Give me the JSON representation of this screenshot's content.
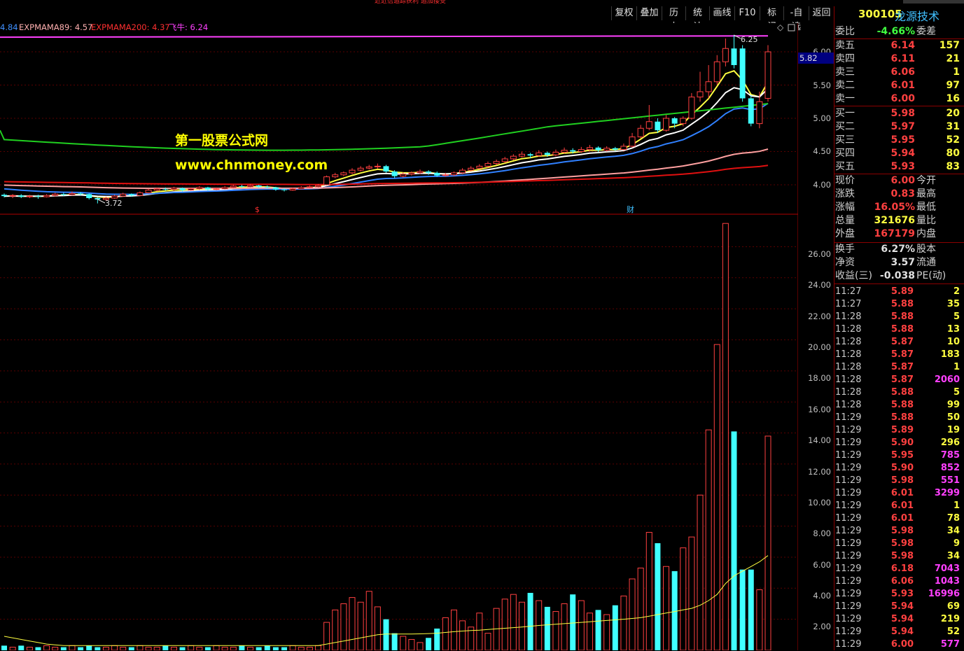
{
  "toolbar": {
    "buttons": [
      "复权",
      "叠加",
      "历史",
      "统计",
      "画线",
      "F10",
      "标记",
      "-自选",
      "返回"
    ],
    "stock_code": "300105",
    "stock_name": "龙源技术",
    "top_strip_text": "近近信追踪获利 追加接受"
  },
  "indicator_legend": [
    {
      "text": "4.84",
      "color": "#4090ff"
    },
    {
      "text": "EXPMAMA89: 4.57",
      "color": "#ffb0b0"
    },
    {
      "text": "EXPMAMA200: 4.37",
      "color": "#ff3030"
    },
    {
      "text": "飞牛: 6.24",
      "color": "#ff40ff"
    }
  ],
  "watermark": {
    "line1": "第一股票公式网",
    "line2": "www.chnmoney.com"
  },
  "price_axis": {
    "ticks": [
      "6.00",
      "5.50",
      "5.00",
      "4.50",
      "4.00"
    ],
    "current_marker": "5.82",
    "high_label": "6.25",
    "low_label": "3.72",
    "event_markers": [
      "$",
      "财"
    ]
  },
  "volume_axis": {
    "ticks": [
      "26.00",
      "24.00",
      "22.00",
      "20.00",
      "18.00",
      "16.00",
      "14.00",
      "12.00",
      "10.00",
      "8.00",
      "6.00",
      "4.00",
      "2.00"
    ]
  },
  "chart_data": {
    "type": "candlestick",
    "price_range": [
      3.55,
      6.35
    ],
    "volume_range": [
      0,
      27.5
    ],
    "candles": [
      [
        3.85,
        3.83,
        3.87,
        3.81
      ],
      [
        3.83,
        3.84,
        3.86,
        3.8
      ],
      [
        3.84,
        3.82,
        3.86,
        3.8
      ],
      [
        3.82,
        3.83,
        3.85,
        3.8
      ],
      [
        3.83,
        3.82,
        3.85,
        3.79
      ],
      [
        3.82,
        3.84,
        3.86,
        3.81
      ],
      [
        3.84,
        3.86,
        3.88,
        3.82
      ],
      [
        3.86,
        3.85,
        3.88,
        3.83
      ],
      [
        3.85,
        3.87,
        3.9,
        3.84
      ],
      [
        3.87,
        3.86,
        3.89,
        3.84
      ],
      [
        3.86,
        3.8,
        3.87,
        3.78
      ],
      [
        3.8,
        3.78,
        3.81,
        3.72
      ],
      [
        3.78,
        3.8,
        3.82,
        3.76
      ],
      [
        3.8,
        3.83,
        3.85,
        3.79
      ],
      [
        3.83,
        3.86,
        3.88,
        3.82
      ],
      [
        3.86,
        3.84,
        3.87,
        3.82
      ],
      [
        3.84,
        3.88,
        3.9,
        3.83
      ],
      [
        3.88,
        3.92,
        3.94,
        3.87
      ],
      [
        3.92,
        3.94,
        3.96,
        3.9
      ],
      [
        3.94,
        3.93,
        3.96,
        3.91
      ],
      [
        3.93,
        3.95,
        3.97,
        3.91
      ],
      [
        3.95,
        3.92,
        3.96,
        3.9
      ],
      [
        3.92,
        3.94,
        3.96,
        3.91
      ],
      [
        3.94,
        3.96,
        3.98,
        3.92
      ],
      [
        3.96,
        3.93,
        3.97,
        3.91
      ],
      [
        3.93,
        3.94,
        3.96,
        3.92
      ],
      [
        3.94,
        3.96,
        3.98,
        3.93
      ],
      [
        3.96,
        3.98,
        4.0,
        3.95
      ],
      [
        3.98,
        3.97,
        4.0,
        3.95
      ],
      [
        3.97,
        3.99,
        4.01,
        3.96
      ],
      [
        3.99,
        3.97,
        4.0,
        3.95
      ],
      [
        3.97,
        3.96,
        3.99,
        3.94
      ],
      [
        3.96,
        3.93,
        3.97,
        3.91
      ],
      [
        3.93,
        3.92,
        3.95,
        3.9
      ],
      [
        3.92,
        3.94,
        3.96,
        3.91
      ],
      [
        3.94,
        3.96,
        3.98,
        3.93
      ],
      [
        3.96,
        3.97,
        3.99,
        3.95
      ],
      [
        3.97,
        3.99,
        4.01,
        3.96
      ],
      [
        4.0,
        4.12,
        4.14,
        3.99
      ],
      [
        4.12,
        4.15,
        4.18,
        4.1
      ],
      [
        4.15,
        4.18,
        4.2,
        4.13
      ],
      [
        4.18,
        4.22,
        4.25,
        4.16
      ],
      [
        4.22,
        4.25,
        4.28,
        4.2
      ],
      [
        4.25,
        4.27,
        4.3,
        4.23
      ],
      [
        4.27,
        4.28,
        4.32,
        4.24
      ],
      [
        4.28,
        4.2,
        4.3,
        4.18
      ],
      [
        4.2,
        4.13,
        4.22,
        4.1
      ],
      [
        4.13,
        4.16,
        4.19,
        4.11
      ],
      [
        4.16,
        4.18,
        4.2,
        4.14
      ],
      [
        4.18,
        4.2,
        4.23,
        4.16
      ],
      [
        4.2,
        4.18,
        4.22,
        4.15
      ],
      [
        4.18,
        4.14,
        4.2,
        4.12
      ],
      [
        4.14,
        4.15,
        4.18,
        4.12
      ],
      [
        4.15,
        4.18,
        4.2,
        4.13
      ],
      [
        4.18,
        4.22,
        4.25,
        4.16
      ],
      [
        4.22,
        4.25,
        4.28,
        4.2
      ],
      [
        4.25,
        4.28,
        4.31,
        4.23
      ],
      [
        4.28,
        4.32,
        4.35,
        4.26
      ],
      [
        4.32,
        4.35,
        4.38,
        4.3
      ],
      [
        4.35,
        4.39,
        4.42,
        4.33
      ],
      [
        4.39,
        4.43,
        4.46,
        4.37
      ],
      [
        4.43,
        4.46,
        4.5,
        4.41
      ],
      [
        4.46,
        4.44,
        4.48,
        4.4
      ],
      [
        4.44,
        4.48,
        4.52,
        4.42
      ],
      [
        4.48,
        4.45,
        4.5,
        4.42
      ],
      [
        4.45,
        4.49,
        4.53,
        4.43
      ],
      [
        4.49,
        4.52,
        4.56,
        4.47
      ],
      [
        4.52,
        4.5,
        4.55,
        4.47
      ],
      [
        4.5,
        4.53,
        4.57,
        4.48
      ],
      [
        4.53,
        4.56,
        4.6,
        4.5
      ],
      [
        4.56,
        4.52,
        4.58,
        4.49
      ],
      [
        4.52,
        4.55,
        4.58,
        4.5
      ],
      [
        4.55,
        4.53,
        4.57,
        4.51
      ],
      [
        4.53,
        4.58,
        4.62,
        4.52
      ],
      [
        4.58,
        4.72,
        4.78,
        4.56
      ],
      [
        4.72,
        4.85,
        4.9,
        4.7
      ],
      [
        4.85,
        4.95,
        5.2,
        4.82
      ],
      [
        4.95,
        4.82,
        5.0,
        4.78
      ],
      [
        4.82,
        5.0,
        5.05,
        4.8
      ],
      [
        5.0,
        4.92,
        5.02,
        4.85
      ],
      [
        4.92,
        5.0,
        5.03,
        4.88
      ],
      [
        5.0,
        5.32,
        5.38,
        4.98
      ],
      [
        5.32,
        5.4,
        5.7,
        5.25
      ],
      [
        5.4,
        5.55,
        5.8,
        5.3
      ],
      [
        5.55,
        5.85,
        5.95,
        5.5
      ],
      [
        5.85,
        6.05,
        6.2,
        5.78
      ],
      [
        6.05,
        5.8,
        6.25,
        5.75
      ],
      [
        6.05,
        5.3,
        6.1,
        5.25
      ],
      [
        5.3,
        4.92,
        5.35,
        4.88
      ],
      [
        4.92,
        5.25,
        5.4,
        4.85
      ],
      [
        5.3,
        6.0,
        6.1,
        5.25
      ]
    ],
    "volumes": [
      0.3,
      0.2,
      0.3,
      0.2,
      0.2,
      0.3,
      0.2,
      0.2,
      0.3,
      0.2,
      0.3,
      0.2,
      0.2,
      0.3,
      0.2,
      0.2,
      0.3,
      0.2,
      0.2,
      0.3,
      0.2,
      0.2,
      0.3,
      0.2,
      0.2,
      0.3,
      0.2,
      0.2,
      0.3,
      0.2,
      0.2,
      0.3,
      0.2,
      0.2,
      0.3,
      0.2,
      0.2,
      0.3,
      1.8,
      2.6,
      3.0,
      3.4,
      3.1,
      3.8,
      2.8,
      2.0,
      1.1,
      0.9,
      0.7,
      0.5,
      0.8,
      1.4,
      2.1,
      2.6,
      1.9,
      1.5,
      2.4,
      1.1,
      2.7,
      3.3,
      3.6,
      3.1,
      3.7,
      3.2,
      2.8,
      2.5,
      3.0,
      3.6,
      3.2,
      2.4,
      2.6,
      2.3,
      2.9,
      3.5,
      4.6,
      5.3,
      7.6,
      6.9,
      5.4,
      5.1,
      6.6,
      7.3,
      10.0,
      14.2,
      19.7,
      27.5,
      14.1,
      5.2,
      5.2,
      3.9,
      13.8
    ],
    "volume_ma": [
      0.9,
      0.8,
      0.7,
      0.6,
      0.5,
      0.4,
      0.35,
      0.3,
      0.3,
      0.3,
      0.3,
      0.3,
      0.3,
      0.3,
      0.3,
      0.3,
      0.3,
      0.3,
      0.3,
      0.3,
      0.3,
      0.3,
      0.3,
      0.3,
      0.3,
      0.3,
      0.3,
      0.3,
      0.3,
      0.3,
      0.3,
      0.3,
      0.3,
      0.3,
      0.3,
      0.3,
      0.3,
      0.3,
      0.4,
      0.5,
      0.6,
      0.7,
      0.8,
      0.9,
      1.0,
      1.05,
      1.05,
      1.05,
      1.05,
      1.06,
      1.08,
      1.1,
      1.15,
      1.2,
      1.24,
      1.27,
      1.3,
      1.34,
      1.38,
      1.42,
      1.46,
      1.5,
      1.55,
      1.6,
      1.64,
      1.68,
      1.72,
      1.76,
      1.8,
      1.84,
      1.88,
      1.92,
      1.96,
      2.0,
      2.05,
      2.1,
      2.2,
      2.3,
      2.4,
      2.5,
      2.6,
      2.7,
      2.9,
      3.2,
      3.6,
      4.3,
      4.8,
      5.1,
      5.4,
      5.7,
      6.1
    ]
  },
  "quote": {
    "weibi": {
      "label": "委比",
      "value": "-4.66%",
      "label2": "委差"
    },
    "asks": [
      {
        "label": "卖五",
        "price": "6.14",
        "vol": "157"
      },
      {
        "label": "卖四",
        "price": "6.11",
        "vol": "21"
      },
      {
        "label": "卖三",
        "price": "6.06",
        "vol": "1"
      },
      {
        "label": "卖二",
        "price": "6.01",
        "vol": "97"
      },
      {
        "label": "卖一",
        "price": "6.00",
        "vol": "16"
      }
    ],
    "bids": [
      {
        "label": "买一",
        "price": "5.98",
        "vol": "20"
      },
      {
        "label": "买二",
        "price": "5.97",
        "vol": "31"
      },
      {
        "label": "买三",
        "price": "5.95",
        "vol": "52"
      },
      {
        "label": "买四",
        "price": "5.94",
        "vol": "80"
      },
      {
        "label": "买五",
        "price": "5.93",
        "vol": "83"
      }
    ],
    "stats": [
      {
        "label": "现价",
        "value": "6.00",
        "label2": "今开",
        "color": "#ff4040"
      },
      {
        "label": "涨跌",
        "value": "0.83",
        "label2": "最高",
        "color": "#ff4040"
      },
      {
        "label": "涨幅",
        "value": "16.05%",
        "label2": "最低",
        "color": "#ff4040"
      },
      {
        "label": "总量",
        "value": "321676",
        "label2": "量比",
        "color": "#ffff40"
      },
      {
        "label": "外盘",
        "value": "167179",
        "label2": "内盘",
        "color": "#ff4040"
      },
      {
        "label": "换手",
        "value": "6.27%",
        "label2": "股本",
        "color": "#e0e0e0"
      },
      {
        "label": "净资",
        "value": "3.57",
        "label2": "流通",
        "color": "#e0e0e0"
      },
      {
        "label": "收益(三)",
        "value": "-0.038",
        "label2": "PE(动)",
        "color": "#e0e0e0"
      }
    ],
    "ticks": [
      {
        "time": "11:27",
        "price": "5.89",
        "vol": "2",
        "vcolor": "#ffff40"
      },
      {
        "time": "11:27",
        "price": "5.88",
        "vol": "35",
        "vcolor": "#ffff40"
      },
      {
        "time": "11:28",
        "price": "5.88",
        "vol": "5",
        "vcolor": "#ffff40"
      },
      {
        "time": "11:28",
        "price": "5.88",
        "vol": "13",
        "vcolor": "#ffff40"
      },
      {
        "time": "11:28",
        "price": "5.87",
        "vol": "10",
        "vcolor": "#ffff40"
      },
      {
        "time": "11:28",
        "price": "5.87",
        "vol": "183",
        "vcolor": "#ffff40"
      },
      {
        "time": "11:28",
        "price": "5.87",
        "vol": "1",
        "vcolor": "#ffff40"
      },
      {
        "time": "11:28",
        "price": "5.87",
        "vol": "2060",
        "vcolor": "#ff40ff"
      },
      {
        "time": "11:28",
        "price": "5.88",
        "vol": "5",
        "vcolor": "#ffff40"
      },
      {
        "time": "11:28",
        "price": "5.88",
        "vol": "99",
        "vcolor": "#ffff40"
      },
      {
        "time": "11:29",
        "price": "5.88",
        "vol": "50",
        "vcolor": "#ffff40"
      },
      {
        "time": "11:29",
        "price": "5.89",
        "vol": "19",
        "vcolor": "#ffff40"
      },
      {
        "time": "11:29",
        "price": "5.90",
        "vol": "296",
        "vcolor": "#ffff40"
      },
      {
        "time": "11:29",
        "price": "5.95",
        "vol": "785",
        "vcolor": "#ff40ff"
      },
      {
        "time": "11:29",
        "price": "5.90",
        "vol": "852",
        "vcolor": "#ff40ff"
      },
      {
        "time": "11:29",
        "price": "5.98",
        "vol": "551",
        "vcolor": "#ff40ff"
      },
      {
        "time": "11:29",
        "price": "6.01",
        "vol": "3299",
        "vcolor": "#ff40ff"
      },
      {
        "time": "11:29",
        "price": "6.01",
        "vol": "1",
        "vcolor": "#ffff40"
      },
      {
        "time": "11:29",
        "price": "6.01",
        "vol": "78",
        "vcolor": "#ffff40"
      },
      {
        "time": "11:29",
        "price": "5.98",
        "vol": "34",
        "vcolor": "#ffff40"
      },
      {
        "time": "11:29",
        "price": "5.98",
        "vol": "9",
        "vcolor": "#ffff40"
      },
      {
        "time": "11:29",
        "price": "5.98",
        "vol": "34",
        "vcolor": "#ffff40"
      },
      {
        "time": "11:29",
        "price": "6.18",
        "vol": "7043",
        "vcolor": "#ff40ff"
      },
      {
        "time": "11:29",
        "price": "6.06",
        "vol": "1043",
        "vcolor": "#ff40ff"
      },
      {
        "time": "11:29",
        "price": "5.93",
        "vol": "16996",
        "vcolor": "#ff40ff"
      },
      {
        "time": "11:29",
        "price": "5.94",
        "vol": "69",
        "vcolor": "#ffff40"
      },
      {
        "time": "11:29",
        "price": "5.94",
        "vol": "219",
        "vcolor": "#ffff40"
      },
      {
        "time": "11:29",
        "price": "5.94",
        "vol": "52",
        "vcolor": "#ffff40"
      },
      {
        "time": "11:29",
        "price": "6.00",
        "vol": "577",
        "vcolor": "#ff40ff"
      }
    ]
  }
}
